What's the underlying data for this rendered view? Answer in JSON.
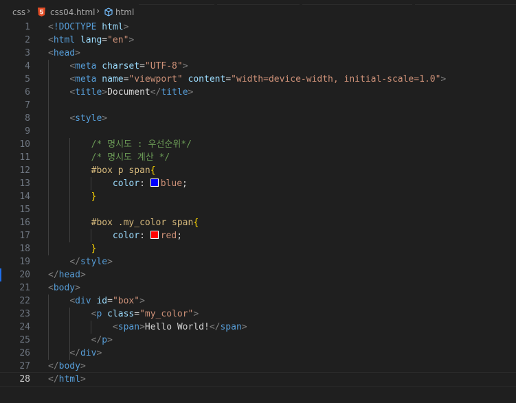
{
  "breadcrumb": {
    "folder": "css",
    "file": "css04.html",
    "symbol": "html"
  },
  "colors": {
    "blue_swatch": "#0000ff",
    "red_swatch": "#ff0000",
    "accent": "#1f6feb"
  },
  "current_line": 28,
  "editor": {
    "lines": [
      {
        "n": "1",
        "tokens": [
          [
            "punc",
            "<"
          ],
          [
            "tag",
            "!DOCTYPE"
          ],
          [
            "text",
            " "
          ],
          [
            "attr",
            "html"
          ],
          [
            "punc",
            ">"
          ]
        ]
      },
      {
        "n": "2",
        "tokens": [
          [
            "punc",
            "<"
          ],
          [
            "tag",
            "html"
          ],
          [
            "text",
            " "
          ],
          [
            "attr",
            "lang"
          ],
          [
            "text",
            "="
          ],
          [
            "str",
            "\"en\""
          ],
          [
            "punc",
            ">"
          ]
        ]
      },
      {
        "n": "3",
        "tokens": [
          [
            "punc",
            "<"
          ],
          [
            "tag",
            "head"
          ],
          [
            "punc",
            ">"
          ]
        ]
      },
      {
        "n": "4",
        "tokens": [
          [
            "text",
            "    "
          ],
          [
            "punc",
            "<"
          ],
          [
            "tag",
            "meta"
          ],
          [
            "text",
            " "
          ],
          [
            "attr",
            "charset"
          ],
          [
            "text",
            "="
          ],
          [
            "str",
            "\"UTF-8\""
          ],
          [
            "punc",
            ">"
          ]
        ]
      },
      {
        "n": "5",
        "tokens": [
          [
            "text",
            "    "
          ],
          [
            "punc",
            "<"
          ],
          [
            "tag",
            "meta"
          ],
          [
            "text",
            " "
          ],
          [
            "attr",
            "name"
          ],
          [
            "text",
            "="
          ],
          [
            "str",
            "\"viewport\""
          ],
          [
            "text",
            " "
          ],
          [
            "attr",
            "content"
          ],
          [
            "text",
            "="
          ],
          [
            "str",
            "\"width=device-width, initial-scale=1.0\""
          ],
          [
            "punc",
            ">"
          ]
        ]
      },
      {
        "n": "6",
        "tokens": [
          [
            "text",
            "    "
          ],
          [
            "punc",
            "<"
          ],
          [
            "tag",
            "title"
          ],
          [
            "punc",
            ">"
          ],
          [
            "text",
            "Document"
          ],
          [
            "punc",
            "</"
          ],
          [
            "tag",
            "title"
          ],
          [
            "punc",
            ">"
          ]
        ]
      },
      {
        "n": "7",
        "tokens": []
      },
      {
        "n": "8",
        "tokens": [
          [
            "text",
            "    "
          ],
          [
            "punc",
            "<"
          ],
          [
            "tag",
            "style"
          ],
          [
            "punc",
            ">"
          ]
        ]
      },
      {
        "n": "9",
        "tokens": []
      },
      {
        "n": "10",
        "tokens": [
          [
            "text",
            "        "
          ],
          [
            "com",
            "/* 명시도 : 우선순위*/"
          ]
        ]
      },
      {
        "n": "11",
        "tokens": [
          [
            "text",
            "        "
          ],
          [
            "com",
            "/* 명시도 계산 */"
          ]
        ]
      },
      {
        "n": "12",
        "tokens": [
          [
            "text",
            "        "
          ],
          [
            "sel",
            "#box p span"
          ],
          [
            "brace",
            "{"
          ]
        ]
      },
      {
        "n": "13",
        "tokens": [
          [
            "text",
            "            "
          ],
          [
            "prop",
            "color"
          ],
          [
            "text",
            ": "
          ],
          [
            "swatch",
            "blue"
          ],
          [
            "val",
            "blue"
          ],
          [
            "text",
            ";"
          ]
        ]
      },
      {
        "n": "14",
        "tokens": [
          [
            "text",
            "        "
          ],
          [
            "brace",
            "}"
          ]
        ]
      },
      {
        "n": "15",
        "tokens": []
      },
      {
        "n": "16",
        "tokens": [
          [
            "text",
            "        "
          ],
          [
            "sel",
            "#box .my_color span"
          ],
          [
            "brace",
            "{"
          ]
        ]
      },
      {
        "n": "17",
        "tokens": [
          [
            "text",
            "            "
          ],
          [
            "prop",
            "color"
          ],
          [
            "text",
            ": "
          ],
          [
            "swatch",
            "red"
          ],
          [
            "val",
            "red"
          ],
          [
            "text",
            ";"
          ]
        ]
      },
      {
        "n": "18",
        "tokens": [
          [
            "text",
            "        "
          ],
          [
            "brace",
            "}"
          ]
        ]
      },
      {
        "n": "19",
        "tokens": [
          [
            "text",
            "    "
          ],
          [
            "punc",
            "</"
          ],
          [
            "tag",
            "style"
          ],
          [
            "punc",
            ">"
          ]
        ]
      },
      {
        "n": "20",
        "tokens": [
          [
            "punc",
            "</"
          ],
          [
            "tag",
            "head"
          ],
          [
            "punc",
            ">"
          ]
        ]
      },
      {
        "n": "21",
        "tokens": [
          [
            "punc",
            "<"
          ],
          [
            "tag",
            "body"
          ],
          [
            "punc",
            ">"
          ]
        ]
      },
      {
        "n": "22",
        "tokens": [
          [
            "text",
            "    "
          ],
          [
            "punc",
            "<"
          ],
          [
            "tag",
            "div"
          ],
          [
            "text",
            " "
          ],
          [
            "attr",
            "id"
          ],
          [
            "text",
            "="
          ],
          [
            "str",
            "\"box\""
          ],
          [
            "punc",
            ">"
          ]
        ]
      },
      {
        "n": "23",
        "tokens": [
          [
            "text",
            "        "
          ],
          [
            "punc",
            "<"
          ],
          [
            "tag",
            "p"
          ],
          [
            "text",
            " "
          ],
          [
            "attr",
            "class"
          ],
          [
            "text",
            "="
          ],
          [
            "str",
            "\"my_color\""
          ],
          [
            "punc",
            ">"
          ]
        ]
      },
      {
        "n": "24",
        "tokens": [
          [
            "text",
            "            "
          ],
          [
            "punc",
            "<"
          ],
          [
            "tag",
            "span"
          ],
          [
            "punc",
            ">"
          ],
          [
            "text",
            "Hello World!"
          ],
          [
            "punc",
            "</"
          ],
          [
            "tag",
            "span"
          ],
          [
            "punc",
            ">"
          ]
        ]
      },
      {
        "n": "25",
        "tokens": [
          [
            "text",
            "        "
          ],
          [
            "punc",
            "</"
          ],
          [
            "tag",
            "p"
          ],
          [
            "punc",
            ">"
          ]
        ]
      },
      {
        "n": "26",
        "tokens": [
          [
            "text",
            "    "
          ],
          [
            "punc",
            "</"
          ],
          [
            "tag",
            "div"
          ],
          [
            "punc",
            ">"
          ]
        ]
      },
      {
        "n": "27",
        "tokens": [
          [
            "punc",
            "</"
          ],
          [
            "tag",
            "body"
          ],
          [
            "punc",
            ">"
          ]
        ]
      },
      {
        "n": "28",
        "tokens": [
          [
            "punc",
            "</"
          ],
          [
            "tag",
            "html"
          ],
          [
            "punc",
            ">"
          ]
        ]
      }
    ]
  }
}
